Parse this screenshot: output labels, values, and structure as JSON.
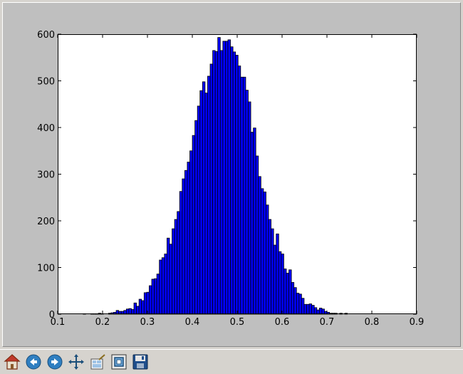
{
  "window": {
    "background": "#bfbfbf"
  },
  "toolbar": {
    "buttons": [
      {
        "name": "home-icon",
        "label": "Home"
      },
      {
        "name": "back-icon",
        "label": "Back"
      },
      {
        "name": "forward-icon",
        "label": "Forward"
      },
      {
        "name": "pan-icon",
        "label": "Pan"
      },
      {
        "name": "subplots-icon",
        "label": "Configure subplots"
      },
      {
        "name": "zoom-icon",
        "label": "Zoom to rectangle"
      },
      {
        "name": "save-icon",
        "label": "Save"
      }
    ]
  },
  "chart_data": {
    "type": "bar",
    "title": "",
    "xlabel": "",
    "ylabel": "",
    "xlim": [
      0.1,
      0.9
    ],
    "ylim": [
      0,
      600
    ],
    "xticks": [
      "0.1",
      "0.2",
      "0.3",
      "0.4",
      "0.5",
      "0.6",
      "0.7",
      "0.8",
      "0.9"
    ],
    "yticks": [
      "0",
      "100",
      "200",
      "300",
      "400",
      "500",
      "600"
    ],
    "bar_color": "#0000ff",
    "edge_color": "#000000",
    "bin_start": 0.1567,
    "bin_width": 0.00566,
    "counts": [
      1,
      0,
      0,
      1,
      1,
      1,
      2,
      1,
      0,
      0,
      2,
      3,
      4,
      8,
      6,
      6,
      8,
      11,
      12,
      10,
      24,
      17,
      32,
      29,
      46,
      47,
      61,
      75,
      76,
      86,
      116,
      121,
      129,
      163,
      150,
      183,
      203,
      220,
      263,
      290,
      308,
      326,
      350,
      383,
      415,
      446,
      479,
      498,
      474,
      510,
      536,
      565,
      563,
      593,
      565,
      585,
      585,
      588,
      573,
      562,
      555,
      532,
      508,
      508,
      480,
      455,
      390,
      399,
      339,
      295,
      269,
      262,
      234,
      203,
      183,
      148,
      172,
      134,
      129,
      97,
      88,
      95,
      68,
      57,
      45,
      43,
      34,
      21,
      21,
      22,
      19,
      14,
      9,
      13,
      11,
      6,
      4,
      2,
      2,
      2,
      0,
      2,
      0,
      2
    ]
  }
}
